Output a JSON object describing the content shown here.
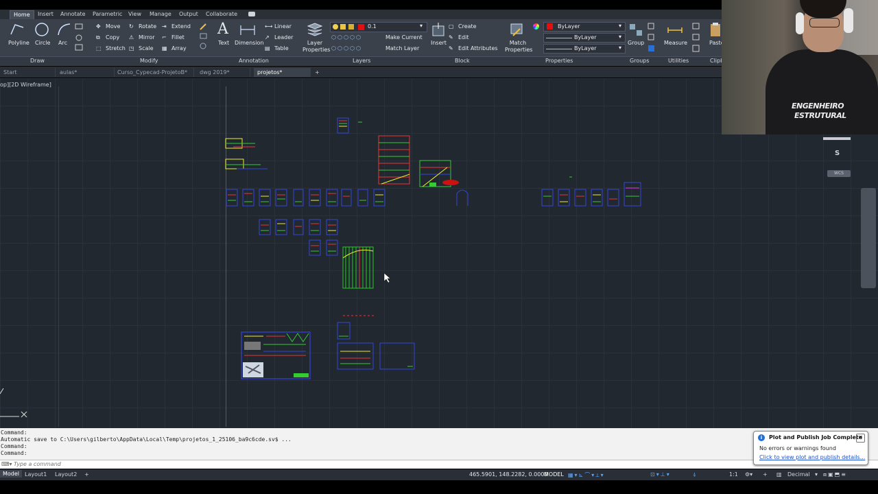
{
  "menu_tabs": [
    "Home",
    "Insert",
    "Annotate",
    "Parametric",
    "View",
    "Manage",
    "Output",
    "Collaborate"
  ],
  "ribbon": {
    "draw": [
      "Polyline",
      "Circle",
      "Arc"
    ],
    "modify_col1": [
      "Move",
      "Copy",
      "Stretch"
    ],
    "modify_col2": [
      "Rotate",
      "Mirror",
      "Scale"
    ],
    "modify_col3": [
      "Extend",
      "Fillet",
      "Array"
    ],
    "annotation_big": [
      "Text",
      "Dimension"
    ],
    "annotation_small": [
      "Linear",
      "Leader",
      "Table"
    ],
    "layer_properties": "Layer Properties",
    "layer_current": "0.1",
    "layer_actions": [
      "Make Current",
      "Match Layer"
    ],
    "insert": "Insert",
    "block_actions": [
      "Create",
      "Edit",
      "Edit Attributes"
    ],
    "match_properties": "Match Properties",
    "bylayer": [
      "ByLayer",
      "ByLayer",
      "ByLayer"
    ],
    "group": "Group",
    "measure": "Measure",
    "paste": "Paste",
    "panels": [
      "Draw",
      "Modify",
      "Annotation",
      "Layers",
      "Block",
      "Properties",
      "Groups",
      "Utilities",
      "Clipb"
    ]
  },
  "file_tabs": [
    "Start",
    "aulas*",
    "Curso_Cypecad-ProjetoB*",
    "dwg 2019*",
    "projetos*"
  ],
  "viewport_label": "op][2D Wireframe]",
  "viewcube": {
    "compass": "S",
    "wcs": "WCS"
  },
  "command_history": [
    "Command:",
    "Automatic save to C:\\Users\\gilberto\\AppData\\Local\\Temp\\projetos_1_25106_ba9c6cde.sv$ ...",
    "Command:",
    "Command:"
  ],
  "command_placeholder": "Type a command",
  "layout_tabs": [
    "Model",
    "Layout1",
    "Layout2"
  ],
  "status": {
    "coords": "465.5901, 148.2282, 0.0000",
    "mode": "MODEL",
    "scale": "1:1",
    "units": "Decimal"
  },
  "notification": {
    "title": "Plot and Publish Job Complete",
    "message": "No errors or warnings found",
    "link": "Click to view plot and publish details..."
  },
  "webcam_shirt": [
    "ENGENHEIRO",
    "ESTRUTURAL"
  ],
  "colors": {
    "canvas": "#212830",
    "ribbon": "#3b414b",
    "accent": "#1f6fd6",
    "layer_color": "#e01010"
  }
}
